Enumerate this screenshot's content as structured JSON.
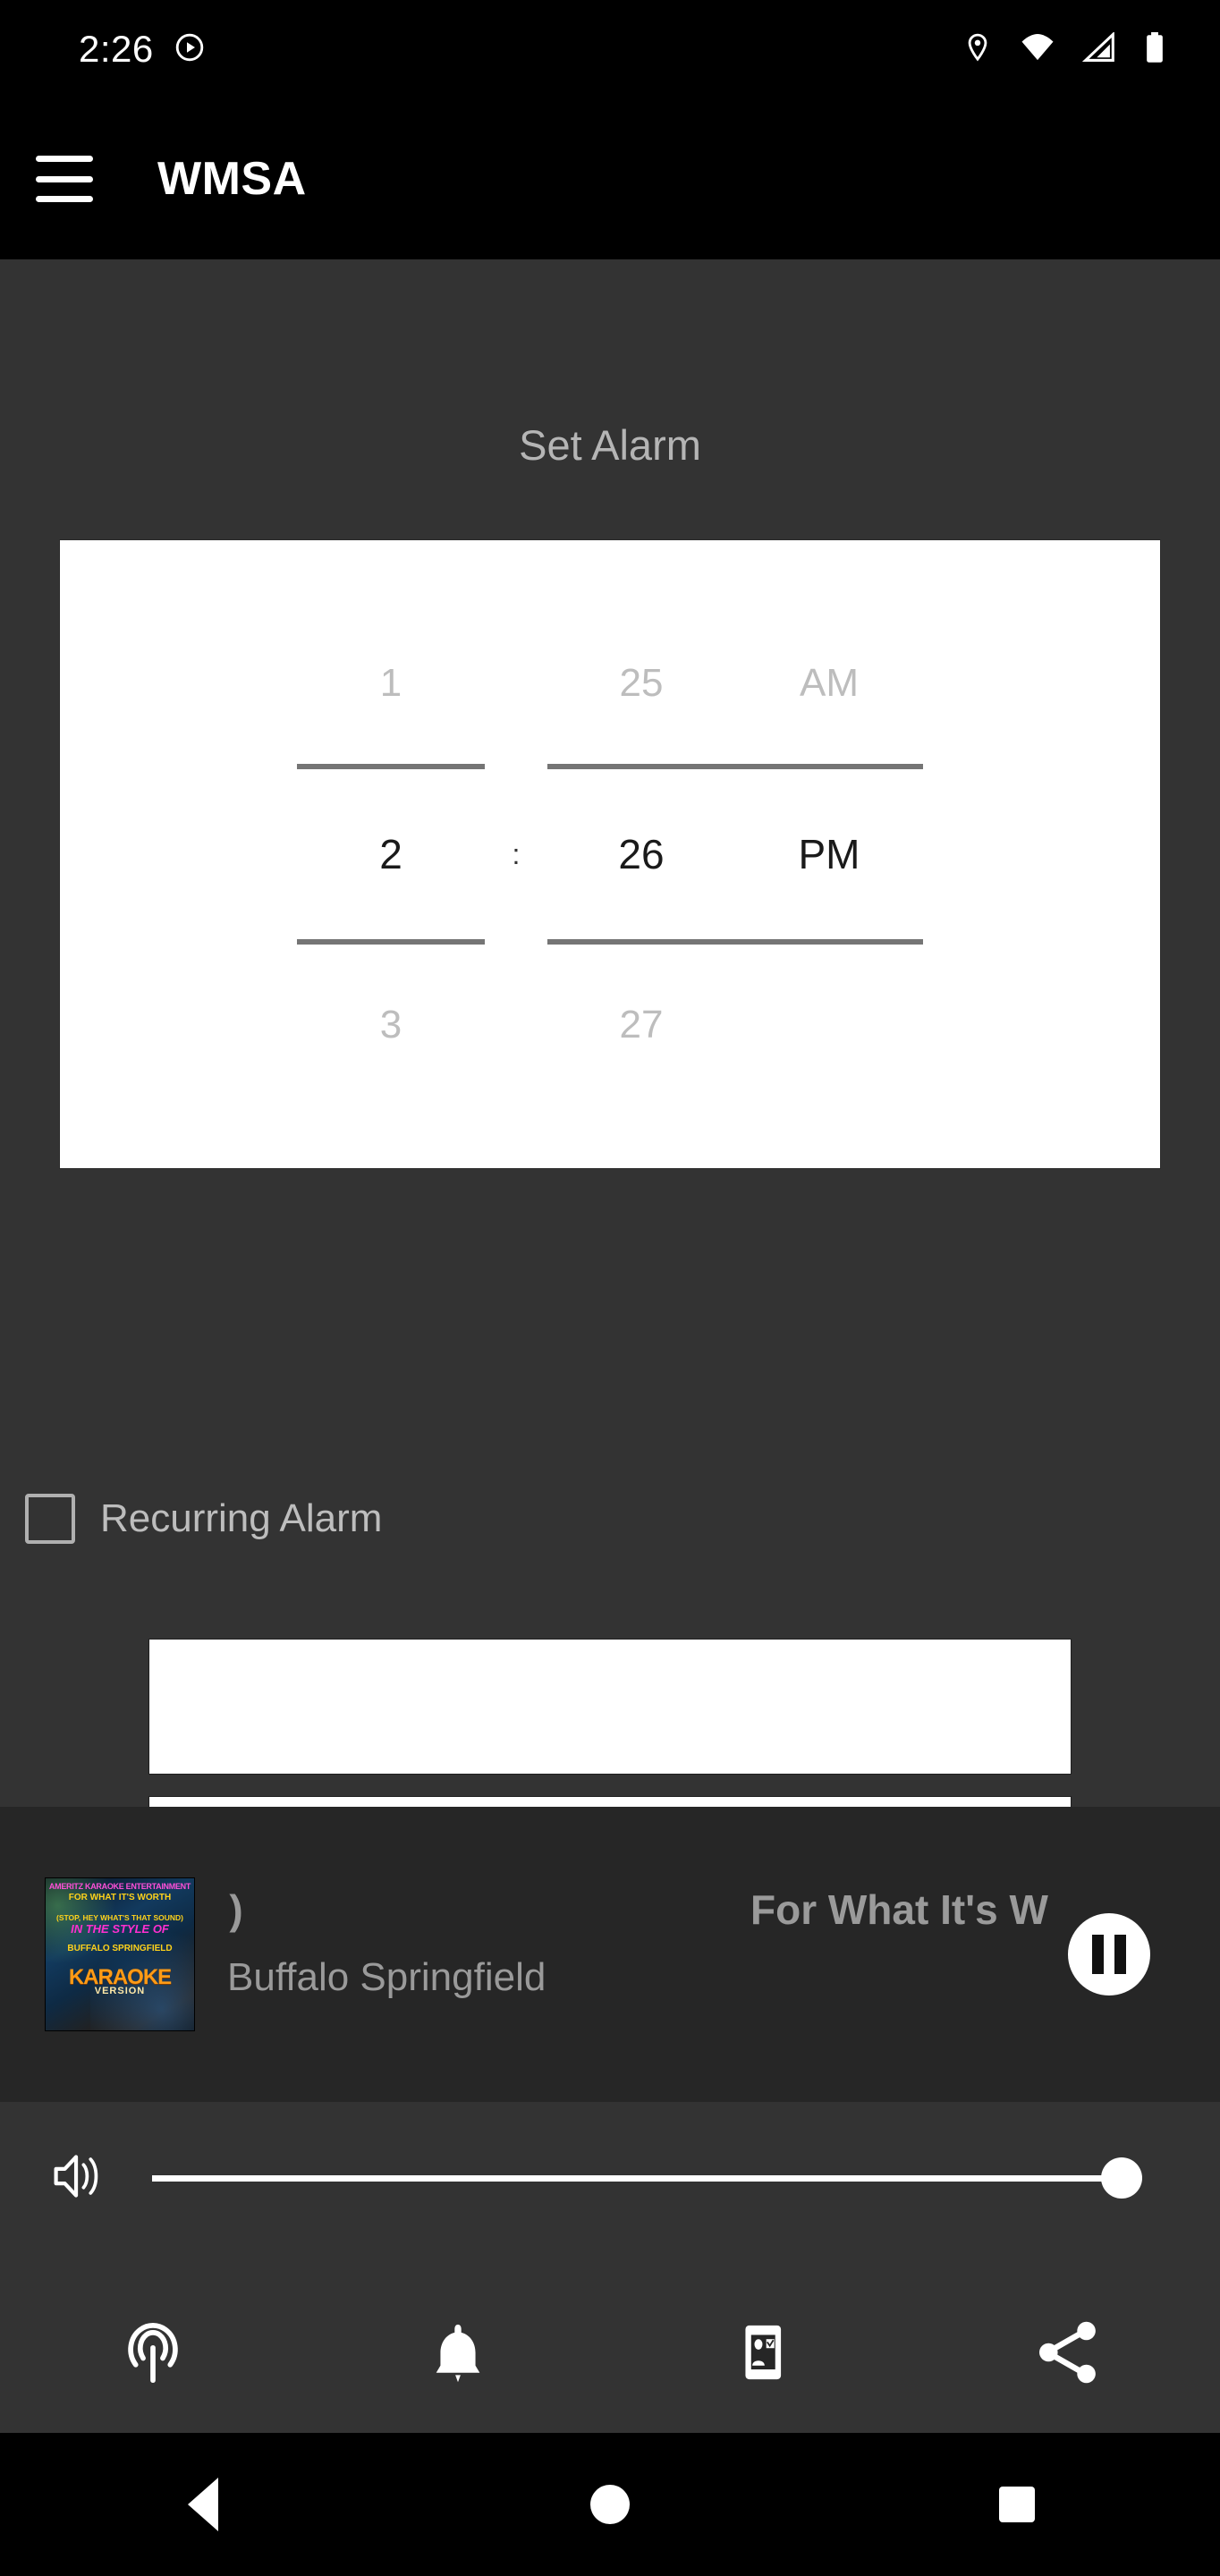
{
  "status_bar": {
    "clock": "2:26",
    "icons": [
      "play-circle-icon",
      "location-icon",
      "wifi-icon",
      "cellular-icon",
      "battery-icon"
    ]
  },
  "app_bar": {
    "menu_icon": "hamburger-menu-icon",
    "title": "WMSA"
  },
  "main": {
    "section_title": "Set Alarm",
    "time_picker": {
      "hour": {
        "previous": "1",
        "selected": "2",
        "next": "3"
      },
      "separator": ":",
      "minute": {
        "previous": "25",
        "selected": "26",
        "next": "27"
      },
      "meridiem": {
        "previous": "AM",
        "selected": "PM",
        "next": ""
      }
    },
    "recurring": {
      "label": "Recurring Alarm",
      "checked": false
    },
    "action_boxes": [
      {
        "label": ""
      },
      {
        "label": ""
      }
    ],
    "drag_handle": "drag-handle-icon"
  },
  "media_player": {
    "album_art": {
      "line1": "AMERITZ KARAOKE ENTERTAINMENT",
      "line2": "FOR WHAT IT'S WORTH",
      "line3": "(STOP, HEY WHAT'S THAT SOUND)",
      "line4": "IN THE STYLE OF",
      "line5": "BUFFALO SPRINGFIELD",
      "line6": "KARAOKE",
      "line7": "VERSION"
    },
    "title_segment_left": "ound)",
    "title_segment_right": "For What It's W",
    "artist": "Buffalo Springfield",
    "transport_button": "pause-icon"
  },
  "volume": {
    "icon": "volume-up-icon",
    "value": 100
  },
  "bottom_icons": [
    {
      "name": "broadcast-icon"
    },
    {
      "name": "alarm-bell-icon"
    },
    {
      "name": "contact-card-icon"
    },
    {
      "name": "share-icon"
    }
  ],
  "nav_bar": {
    "back": "back-triangle-icon",
    "home": "home-circle-icon",
    "recents": "recents-square-icon"
  },
  "colors": {
    "app_bar_background": "#000000",
    "page_background": "#333333",
    "media_player_background": "#262626",
    "card_background": "#ffffff",
    "muted_text": "#b5b5b5",
    "accent_white": "#ffffff"
  }
}
